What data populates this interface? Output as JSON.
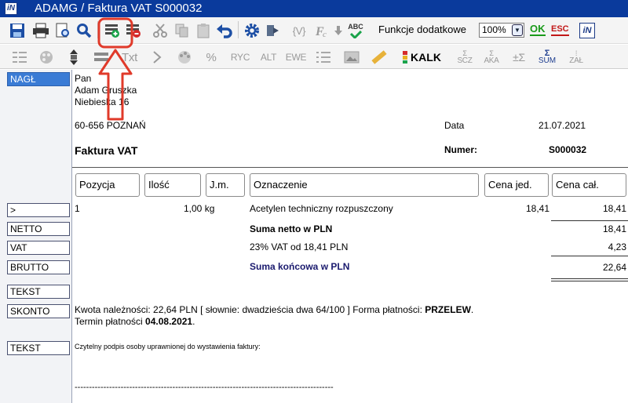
{
  "window": {
    "title": "ADAMG / Faktura VAT S000032",
    "app_icon": "iN"
  },
  "toolbar1": {
    "functions_label": "Funkcje dodatkowe",
    "zoom_value": "100%",
    "ok_label": "OK",
    "esc_label": "ESC",
    "logo_text": "iN",
    "variable_label": "{V}",
    "spell_label": "ABC"
  },
  "toolbar2": {
    "txt": "Txt",
    "percent": "%",
    "ryc": "RYC",
    "alt": "ALT",
    "ewe": "EWE",
    "kalk": "KALK",
    "scz": "SCZ",
    "aka": "AKA",
    "sum": "SUM",
    "zal": "ZAŁ"
  },
  "sections": {
    "nagl": "NAGŁ",
    "position": ">",
    "netto": "NETTO",
    "vat": "VAT",
    "brutto": "BRUTTO",
    "tekst1": "TEKST",
    "skonto": "SKONTO",
    "tekst2": "TEKST"
  },
  "document": {
    "recipient": {
      "line1": "Pan",
      "line2": "Adam Gruszka",
      "line3": "Niebieska 16",
      "line4": "60-656 POZNAŃ"
    },
    "date_label": "Data",
    "date_value": "21.07.2021",
    "doc_title": "Faktura VAT",
    "number_label": "Numer:",
    "number_value": "S000032",
    "columns": {
      "pos": "Pozycja",
      "qty": "Ilość",
      "unit": "J.m.",
      "name": "Oznaczenie",
      "unit_price": "Cena jed.",
      "total_price": "Cena cał."
    },
    "item": {
      "pos": "1",
      "qty": "1,00 kg",
      "name": "Acetylen techniczny rozpuszczony",
      "unit_price": "18,41",
      "total": "18,41"
    },
    "netto_label": "Suma netto w PLN",
    "netto_value": "18,41",
    "vat_label": "23% VAT od 18,41 PLN",
    "vat_value": "4,23",
    "brutto_label": "Suma końcowa w PLN",
    "brutto_value": "22,64",
    "skonto_text": "Kwota należności: 22,64 PLN [ słownie: dwadzieścia dwa 64/100 ] Forma płatności:",
    "payment_form": "PRZELEW",
    "term_label": "Termin płatności",
    "term_value": "04.08.2021",
    "signature_text": "Czytelny podpis osoby uprawnionej do wystawienia faktury:",
    "signature_line": "------------------------------------------------------------------------------------------"
  },
  "colors": {
    "titlebar": "#0a3a9c",
    "active_section": "#3a7bd5",
    "annotation": "#e03a2a"
  }
}
